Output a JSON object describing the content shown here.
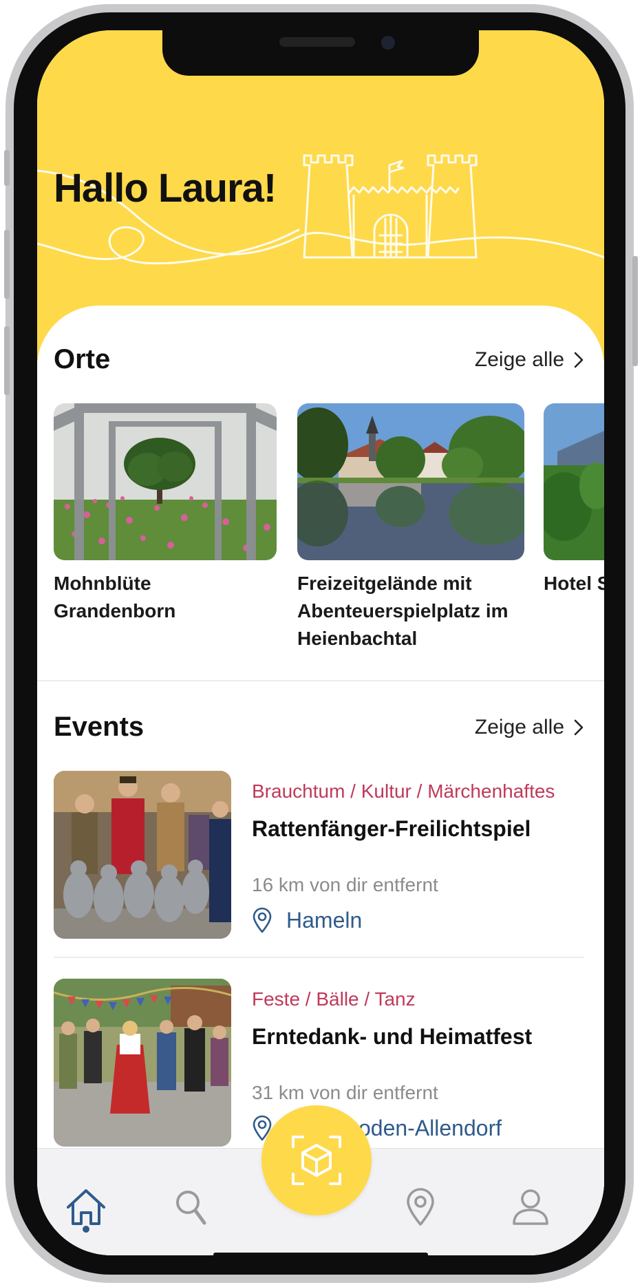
{
  "header": {
    "greeting": "Hallo Laura!"
  },
  "places": {
    "title": "Orte",
    "see_all": "Zeige alle",
    "items": [
      {
        "name_lines": [
          "Mohnblüte",
          "Grandenborn"
        ]
      },
      {
        "name_lines": [
          "Freizeitgelände mit",
          "Abenteuerspielplatz im",
          "Heienbachtal"
        ]
      },
      {
        "name_lines": [
          "Hotel S"
        ]
      }
    ]
  },
  "events": {
    "title": "Events",
    "see_all": "Zeige alle",
    "items": [
      {
        "category": "Brauchtum / Kultur / Märchenhaftes",
        "title": "Rattenfänger-Freilichtspiel",
        "distance": "16 km von dir entfernt",
        "location": "Hameln"
      },
      {
        "category": "Feste / Bälle / Tanz",
        "title": "Erntedank- und Heimatfest",
        "distance": "31 km von dir entfernt",
        "location": "Bad Sooden-Allendorf"
      }
    ]
  },
  "tabbar": {
    "tabs": [
      {
        "icon": "home-icon",
        "active": true
      },
      {
        "icon": "search-icon",
        "active": false
      },
      {
        "icon": "ar-scan-icon",
        "active": false
      },
      {
        "icon": "map-pin-icon",
        "active": false
      },
      {
        "icon": "profile-icon",
        "active": false
      }
    ]
  },
  "colors": {
    "accent_yellow": "#FED94A",
    "category_red": "#C0395A",
    "location_blue": "#2f5a8c"
  }
}
